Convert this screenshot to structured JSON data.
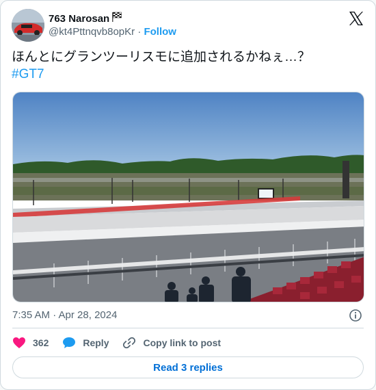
{
  "author": {
    "display_name": "763 Narosan",
    "handle": "@kt4Pttnqvb8opKr",
    "separator": "·",
    "follow_label": "Follow"
  },
  "tweet": {
    "text": "ほんとにグランツーリスモに追加されるかねぇ…？",
    "hashtag": "#GT7",
    "timestamp": "7:35 AM · Apr 28, 2024"
  },
  "actions": {
    "like_count": "362",
    "reply_label": "Reply",
    "copy_link_label": "Copy link to post"
  },
  "footer": {
    "read_replies_label": "Read 3 replies"
  },
  "colors": {
    "accent": "#1d9bf0",
    "like": "#f91880",
    "link": "#006fd6"
  },
  "icons": [
    "checkered-flag-icon",
    "x-logo-icon",
    "info-icon",
    "heart-icon",
    "reply-bubble-icon",
    "link-icon"
  ]
}
